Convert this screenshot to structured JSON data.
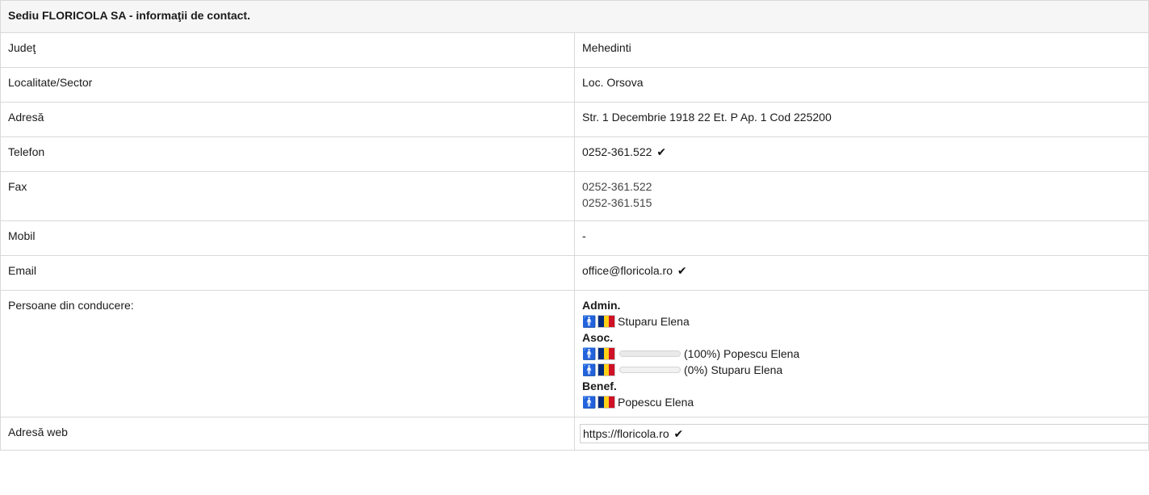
{
  "title": "Sediu FLORICOLA SA - informaţii de contact.",
  "colors": {
    "flag_blue": "#002B7F",
    "flag_yellow": "#FCD116",
    "flag_red": "#CE1126"
  },
  "rows": {
    "judet": {
      "label": "Judeţ",
      "value": "Mehedinti"
    },
    "localitate": {
      "label": "Localitate/Sector",
      "value": "Loc. Orsova"
    },
    "adresa": {
      "label": "Adresă",
      "value": "Str. 1 Decembrie 1918 22 Et. P Ap. 1 Cod 225200"
    },
    "telefon": {
      "label": "Telefon",
      "value": "0252-361.522",
      "icon": "check-icon"
    },
    "fax": {
      "label": "Fax",
      "values": [
        "0252-361.522",
        "0252-361.515"
      ]
    },
    "mobil": {
      "label": "Mobil",
      "value": "-"
    },
    "email": {
      "label": "Email",
      "value": "office@floricola.ro",
      "icon": "check-icon"
    },
    "persoane": {
      "label": "Persoane din conducere:",
      "groups": {
        "admin": {
          "title": "Admin.",
          "people": [
            {
              "name": "Stuparu Elena",
              "icon": "person-icon",
              "flag": "romania-flag-icon"
            }
          ]
        },
        "asoc": {
          "title": "Asoc.",
          "people": [
            {
              "share": 100,
              "share_label": "(100%)",
              "name": "Popescu Elena",
              "icon": "person-icon",
              "flag": "romania-flag-icon"
            },
            {
              "share": 0,
              "share_label": "(0%)",
              "name": "Stuparu Elena",
              "icon": "person-icon",
              "flag": "romania-flag-icon"
            }
          ]
        },
        "benef": {
          "title": "Benef.",
          "people": [
            {
              "name": "Popescu Elena",
              "icon": "person-icon",
              "flag": "romania-flag-icon"
            }
          ]
        }
      }
    },
    "web": {
      "label": "Adresă web",
      "value": "https://floricola.ro",
      "icon": "check-icon"
    }
  }
}
